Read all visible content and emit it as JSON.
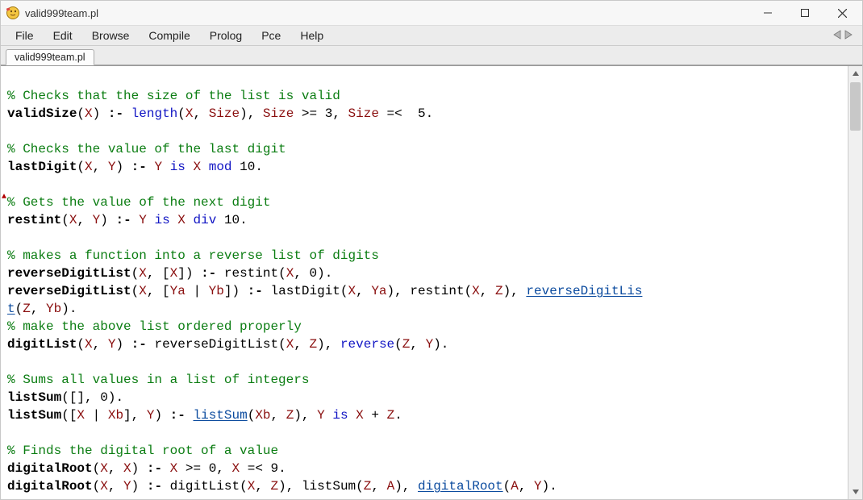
{
  "window": {
    "title": "valid999team.pl"
  },
  "menu": {
    "file": "File",
    "edit": "Edit",
    "browse": "Browse",
    "compile": "Compile",
    "prolog": "Prolog",
    "pce": "Pce",
    "help": "Help"
  },
  "tab": {
    "active": "valid999team.pl"
  },
  "code": {
    "l1_comment": "% Checks that the size of the list is valid",
    "l2_pred": "validSize",
    "l2_neck": " :- ",
    "l2_len": "length",
    "l2_x1": "X",
    "l2_size1": "Size",
    "l2_size2": "Size",
    "l2_num3": "3",
    "l2_size3": "Size",
    "l2_num5": "5",
    "l4_comment": "% Checks the value of the last digit",
    "l5_pred": "lastDigit",
    "l5_x": "X",
    "l5_y": "Y",
    "l5_neck": " :- ",
    "l5_y2": "Y",
    "l5_is": "is",
    "l5_x2": "X",
    "l5_mod": "mod",
    "l5_ten": "10",
    "l7_comment": "% Gets the value of the next digit",
    "l8_pred": "restint",
    "l8_x": "X",
    "l8_y": "Y",
    "l8_neck": " :- ",
    "l8_y2": "Y",
    "l8_is": "is",
    "l8_x2": "X",
    "l8_div": "div",
    "l8_ten": "10",
    "l10_comment": "% makes a function into a reverse list of digits",
    "l11_pred": "reverseDigitList",
    "l11_x": "X",
    "l11_x2": "X",
    "l11_neck": " :- ",
    "l11_rest": "restint",
    "l11_x3": "X",
    "l11_zero": "0",
    "l12_pred": "reverseDigitList",
    "l12_x": "X",
    "l12_ya": "Ya",
    "l12_yb": "Yb",
    "l12_neck": " :- ",
    "l12_ld": "lastDigit",
    "l12_x2": "X",
    "l12_ya2": "Ya",
    "l12_rest": "restint",
    "l12_x3": "X",
    "l12_z": "Z",
    "l12_rdl": "reverseDigitLis",
    "l13_rdl2": "t",
    "l13_z": "Z",
    "l13_yb": "Yb",
    "l14_comment": "% make the above list ordered properly",
    "l15_pred": "digitList",
    "l15_x": "X",
    "l15_y": "Y",
    "l15_neck": " :- ",
    "l15_rdl": "reverseDigitList",
    "l15_x2": "X",
    "l15_z": "Z",
    "l15_rev": "reverse",
    "l15_z2": "Z",
    "l15_y2": "Y",
    "l17_comment": "% Sums all values in a list of integers",
    "l18_pred": "listSum",
    "l18_zero": "0",
    "l19_pred": "listSum",
    "l19_x": "X",
    "l19_xb": "Xb",
    "l19_y": "Y",
    "l19_neck": " :- ",
    "l19_ls": "listSum",
    "l19_xb2": "Xb",
    "l19_z": "Z",
    "l19_y2": "Y",
    "l19_is": "is",
    "l19_x2": "X",
    "l19_z2": "Z",
    "l21_comment": "% Finds the digital root of a value",
    "l22_pred": "digitalRoot",
    "l22_x": "X",
    "l22_x2": "X",
    "l22_neck": " :- ",
    "l22_x3": "X",
    "l22_zero": "0",
    "l22_x4": "X",
    "l22_nine": "9",
    "l23_pred": "digitalRoot",
    "l23_x": "X",
    "l23_y": "Y",
    "l23_neck": " :- ",
    "l23_dl": "digitList",
    "l23_x2": "X",
    "l23_z": "Z",
    "l23_ls": "listSum",
    "l23_z2": "Z",
    "l23_a": "A",
    "l23_dr": "digitalRoot",
    "l23_a2": "A",
    "l23_y2": "Y"
  }
}
